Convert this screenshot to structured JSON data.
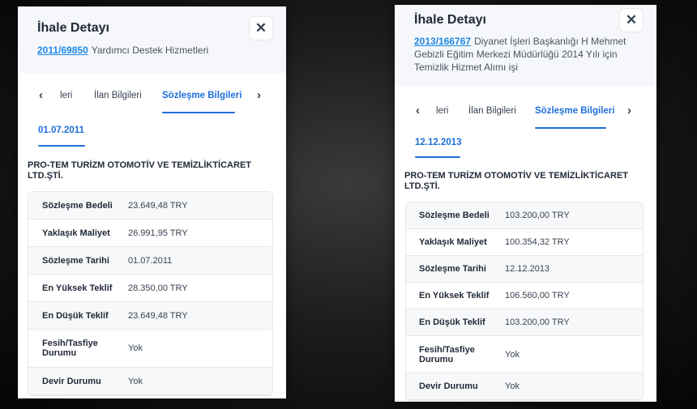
{
  "panels": [
    {
      "title": "İhale Detayı",
      "tender_no": "2011/69850",
      "tender_desc": "Yardımcı Destek Hizmetleri",
      "close_glyph": "✕",
      "tabs": {
        "prev_glyph": "‹",
        "next_glyph": "›",
        "partial": "leri",
        "ilan": "İlan Bilgileri",
        "sozlesme": "Sözleşme Bilgileri"
      },
      "date": "01.07.2011",
      "company": "PRO-TEM TURİZM OTOMOTİV VE TEMİZLİKTİCARET LTD.ŞTİ.",
      "rows": [
        {
          "k": "Sözleşme Bedeli",
          "v": "23.649,48 TRY"
        },
        {
          "k": "Yaklaşık Maliyet",
          "v": "26.991,95 TRY"
        },
        {
          "k": "Sözleşme Tarihi",
          "v": "01.07.2011"
        },
        {
          "k": "En Yüksek Teklif",
          "v": "28.350,00 TRY"
        },
        {
          "k": "En Düşük Teklif",
          "v": "23.649,48 TRY"
        },
        {
          "k": "Fesih/Tasfiye Durumu",
          "v": "Yok"
        },
        {
          "k": "Devir Durumu",
          "v": "Yok"
        }
      ]
    },
    {
      "title": "İhale Detayı",
      "tender_no": "2013/166767",
      "tender_desc": "Diyanet İşleri Başkanlığı H Mehmet Gebizli Eğitim Merkezi Müdürlüğü 2014 Yılı için Temizlik Hizmet Alımı işi",
      "close_glyph": "✕",
      "tabs": {
        "prev_glyph": "‹",
        "next_glyph": "›",
        "partial": "leri",
        "ilan": "İlan Bilgileri",
        "sozlesme": "Sözleşme Bilgileri"
      },
      "date": "12.12.2013",
      "company": "PRO-TEM TURİZM OTOMOTİV VE TEMİZLİKTİCARET LTD.ŞTİ.",
      "rows": [
        {
          "k": "Sözleşme Bedeli",
          "v": "103.200,00 TRY"
        },
        {
          "k": "Yaklaşık Maliyet",
          "v": "100.354,32 TRY"
        },
        {
          "k": "Sözleşme Tarihi",
          "v": "12.12.2013"
        },
        {
          "k": "En Yüksek Teklif",
          "v": "106.560,00 TRY"
        },
        {
          "k": "En Düşük Teklif",
          "v": "103.200,00 TRY"
        },
        {
          "k": "Fesih/Tasfiye Durumu",
          "v": "Yok"
        },
        {
          "k": "Devir Durumu",
          "v": "Yok"
        }
      ]
    }
  ]
}
